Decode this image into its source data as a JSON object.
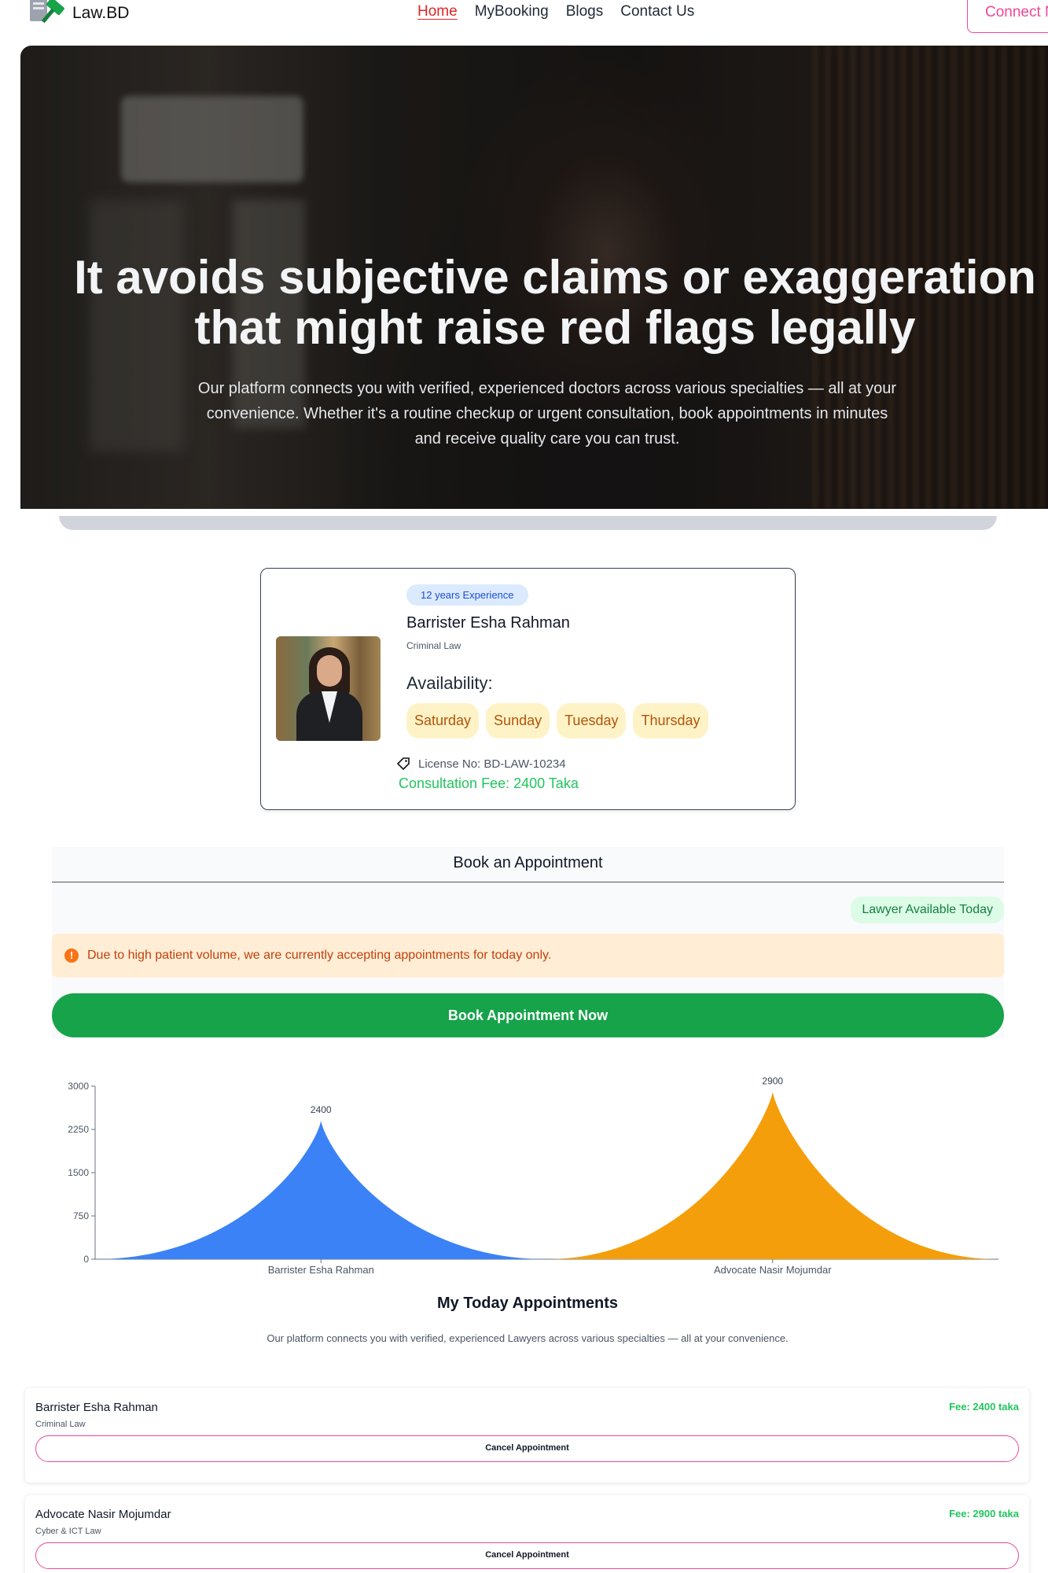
{
  "nav": {
    "logo_text": "Law.BD",
    "links": [
      "Home",
      "MyBooking",
      "Blogs",
      "Contact Us"
    ],
    "connect_label": "Connect N"
  },
  "hero": {
    "title_line1": "It avoids subjective claims or exaggeration",
    "title_line2": "that might raise red flags legally",
    "subtitle": "Our platform connects you with verified, experienced doctors across various specialties — all at your convenience. Whether it's a routine checkup or urgent consultation, book appointments in minutes and receive quality care you can trust."
  },
  "lawyer": {
    "experience": "12 years Experience",
    "name": "Barrister Esha Rahman",
    "specialty": "Criminal Law",
    "availability_label": "Availability:",
    "days": [
      "Saturday",
      "Sunday",
      "Tuesday",
      "Thursday"
    ],
    "license": "License No: BD-LAW-10234",
    "fee": "Consultation Fee: 2400 Taka"
  },
  "booking": {
    "title": "Book an Appointment",
    "available_badge": "Lawyer Available Today",
    "alert_icon": "!",
    "alert": "Due to high patient volume, we are currently accepting appointments for today only.",
    "button": "Book Appointment Now"
  },
  "chart_data": {
    "type": "area",
    "categories": [
      "Barrister Esha Rahman",
      "Advocate Nasir Mojumdar"
    ],
    "values": [
      2400,
      2900
    ],
    "colors": [
      "#3b82f6",
      "#f59e0b"
    ],
    "yticks": [
      0,
      750,
      1500,
      2250,
      3000
    ],
    "ylim": [
      0,
      3000
    ],
    "grid": false
  },
  "appointments": {
    "title": "My Today Appointments",
    "subtitle": "Our platform connects you with verified, experienced Lawyers across various specialties — all at your convenience.",
    "items": [
      {
        "name": "Barrister Esha Rahman",
        "specialty": "Criminal Law",
        "fee": "Fee: 2400 taka",
        "cancel": "Cancel Appointment"
      },
      {
        "name": "Advocate Nasir Mojumdar",
        "specialty": "Cyber & ICT Law",
        "fee": "Fee: 2900 taka",
        "cancel": "Cancel Appointment"
      }
    ]
  }
}
